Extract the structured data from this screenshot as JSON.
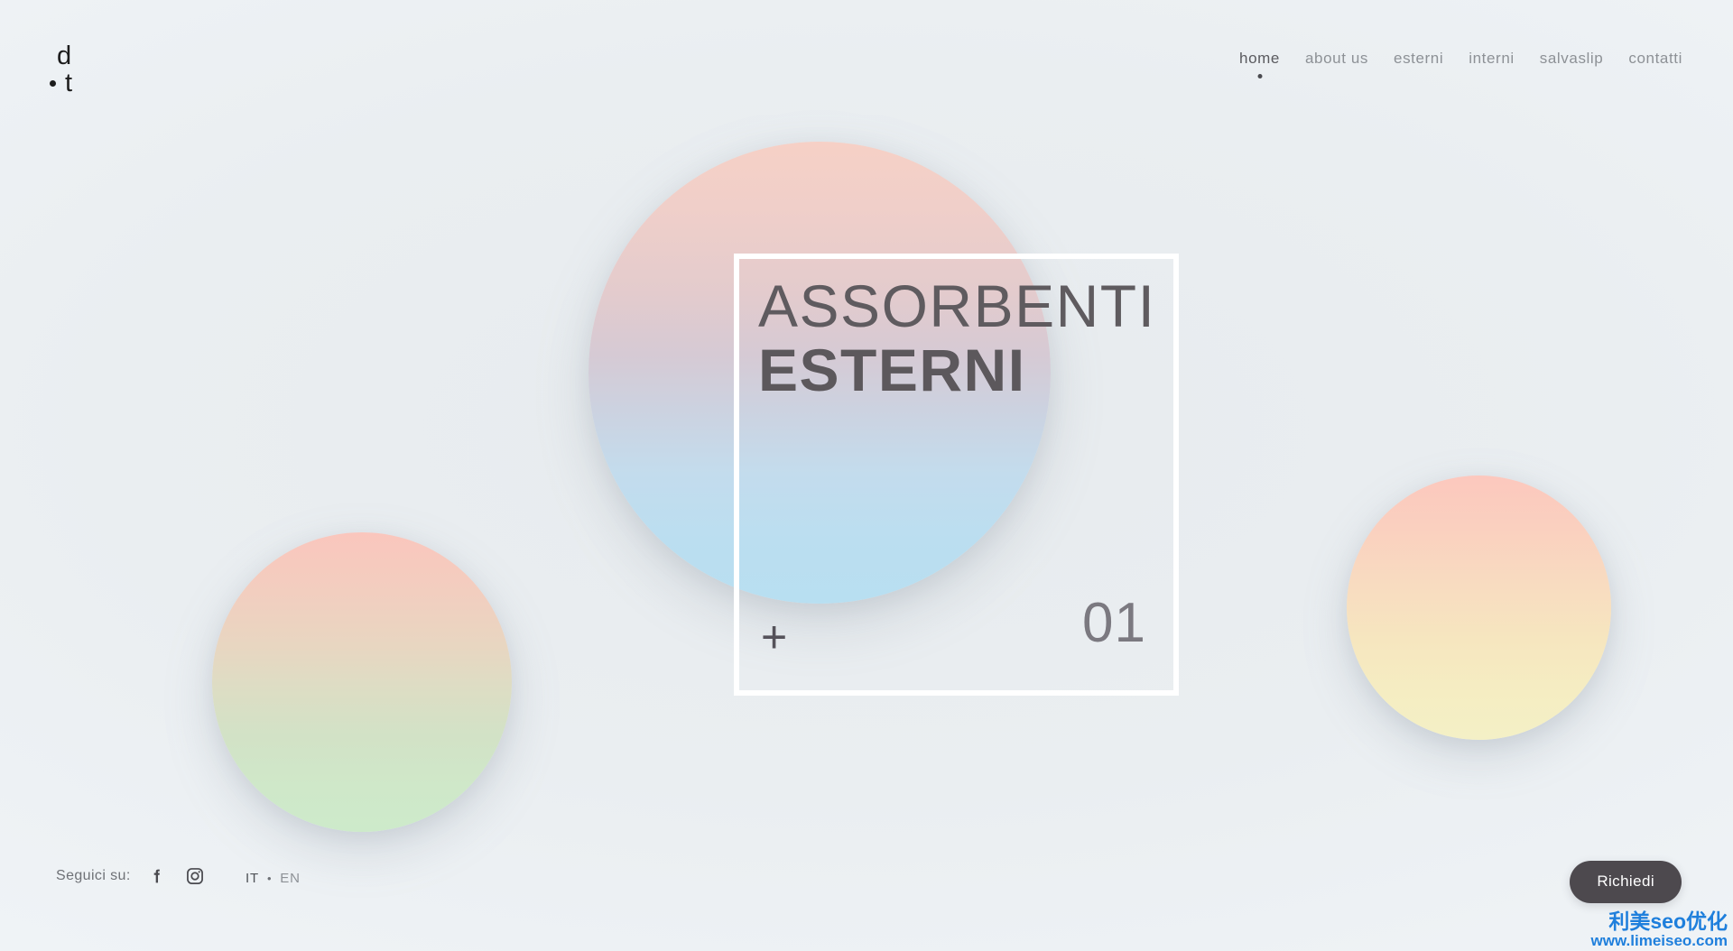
{
  "site": {
    "background_color": "#eaeef1",
    "accent_dark": "#4d494e",
    "text_muted": "#8d9196"
  },
  "logo": {
    "top_letter": "d",
    "bottom_letter": "t",
    "dot": "•"
  },
  "nav": {
    "items": [
      {
        "label": "home",
        "active": true
      },
      {
        "label": "about us",
        "active": false
      },
      {
        "label": "esterni",
        "active": false
      },
      {
        "label": "interni",
        "active": false
      },
      {
        "label": "salvaslip",
        "active": false
      },
      {
        "label": "contatti",
        "active": false
      }
    ]
  },
  "hero": {
    "title_light": "ASSORBENTI",
    "title_bold": "ESTERNI",
    "plus": "+",
    "index": "01",
    "frame_border_color": "#ffffff"
  },
  "decor": {
    "circles": [
      {
        "name": "circle-main",
        "gradient_from": "#f6d0c6",
        "gradient_mid": "#d6cad4",
        "gradient_to": "#b8dff1"
      },
      {
        "name": "circle-left",
        "gradient_from": "#fac6bd",
        "gradient_mid": "#ddddc4",
        "gradient_to": "#cdeaca"
      },
      {
        "name": "circle-right",
        "gradient_from": "#fcc8be",
        "gradient_mid": "#f8dcc0",
        "gradient_to": "#f4f0c6"
      }
    ]
  },
  "footer": {
    "follow_label": "Seguici su:",
    "social": [
      {
        "name": "facebook-icon",
        "label": "f"
      },
      {
        "name": "instagram-icon",
        "label": "Instagram"
      }
    ],
    "languages": {
      "current": "IT",
      "separator": "•",
      "other": "EN"
    },
    "cta_label": "Richiedi"
  },
  "watermark": {
    "line1": "利美seo优化",
    "line2": "www.limeiseo.com",
    "color": "#1f7fdc"
  }
}
